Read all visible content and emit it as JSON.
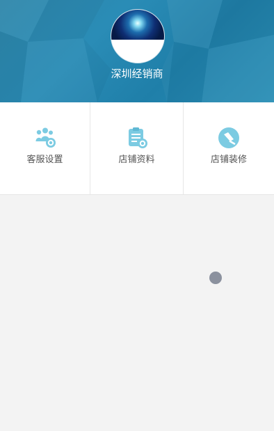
{
  "header": {
    "shop_name": "深圳经销商",
    "background_color": "#2a89b2"
  },
  "menu": {
    "items": [
      {
        "label": "客服设置",
        "icon": "customer-service-settings-icon"
      },
      {
        "label": "店铺资料",
        "icon": "shop-info-clipboard-icon"
      },
      {
        "label": "店铺装修",
        "icon": "shop-decoration-brush-icon"
      }
    ],
    "icon_color": "#7ccbe2"
  },
  "floating_button": {
    "icon": "floating-dot-icon",
    "color": "#858b99"
  }
}
